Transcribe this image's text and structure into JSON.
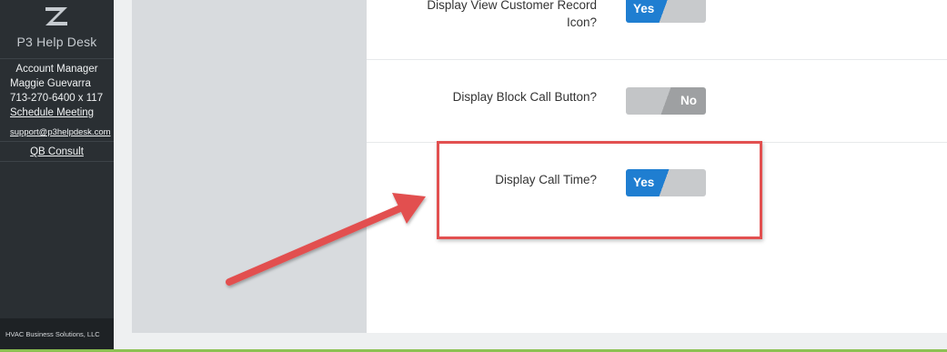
{
  "sidebar": {
    "brand_name": "P3 Help Desk",
    "account_title": "Account Manager",
    "manager_name": "Maggie Guevarra",
    "phone": "713-270-6400 x 117",
    "schedule_link": "Schedule Meeting",
    "email": "support@p3helpdesk.com",
    "qb_link": "QB Consult",
    "footer": "HVAC Business Solutions, LLC"
  },
  "settings": [
    {
      "label_line1": "Display View Customer Record",
      "label_line2": "Icon?",
      "value": "Yes",
      "state": "on"
    },
    {
      "label_line1": "Display Block Call Button?",
      "value": "No",
      "state": "off"
    },
    {
      "label_line1": "Display Call Time?",
      "value": "Yes",
      "state": "on"
    }
  ],
  "colors": {
    "toggle_on": "#1f7ed1",
    "toggle_off": "#9ea0a2",
    "annotation": "#e25050",
    "sidebar_bg": "#2a2f33",
    "accent_strip": "#8cc152"
  },
  "icons": {
    "brand": "zendesk-logo-icon",
    "annotation_arrow": "red-arrow-icon"
  }
}
